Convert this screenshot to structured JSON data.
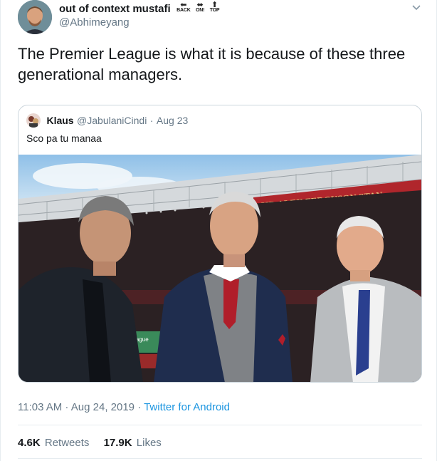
{
  "author": {
    "name": "out of context mustafi",
    "handle": "@Abhimeyang",
    "emojis": [
      {
        "icon": "back-arrow-icon",
        "label": "BACK"
      },
      {
        "icon": "on-arrow-icon",
        "label": "ON!"
      },
      {
        "icon": "top-arrow-icon",
        "label": "TOP"
      }
    ]
  },
  "tweet": {
    "text": "The Premier League is what it is because of these three generational managers."
  },
  "quote": {
    "name": "Klaus",
    "handle": "@JabulaniCindi",
    "separator": "·",
    "date": "Aug 23",
    "text": "Sco pa tu manaa",
    "photo_signs": {
      "stand": "SIR ALEX FERGUSON STAN",
      "board": "League"
    }
  },
  "meta": {
    "time": "11:03 AM",
    "separator1": " · ",
    "date": "Aug 24, 2019",
    "separator2": " · ",
    "source": "Twitter for Android"
  },
  "stats": {
    "retweets_count": "4.6K",
    "retweets_label": "Retweets",
    "likes_count": "17.9K",
    "likes_label": "Likes"
  },
  "colors": {
    "link": "#1b95e0",
    "secondary_text": "#657786",
    "border": "#e6ecf0"
  }
}
